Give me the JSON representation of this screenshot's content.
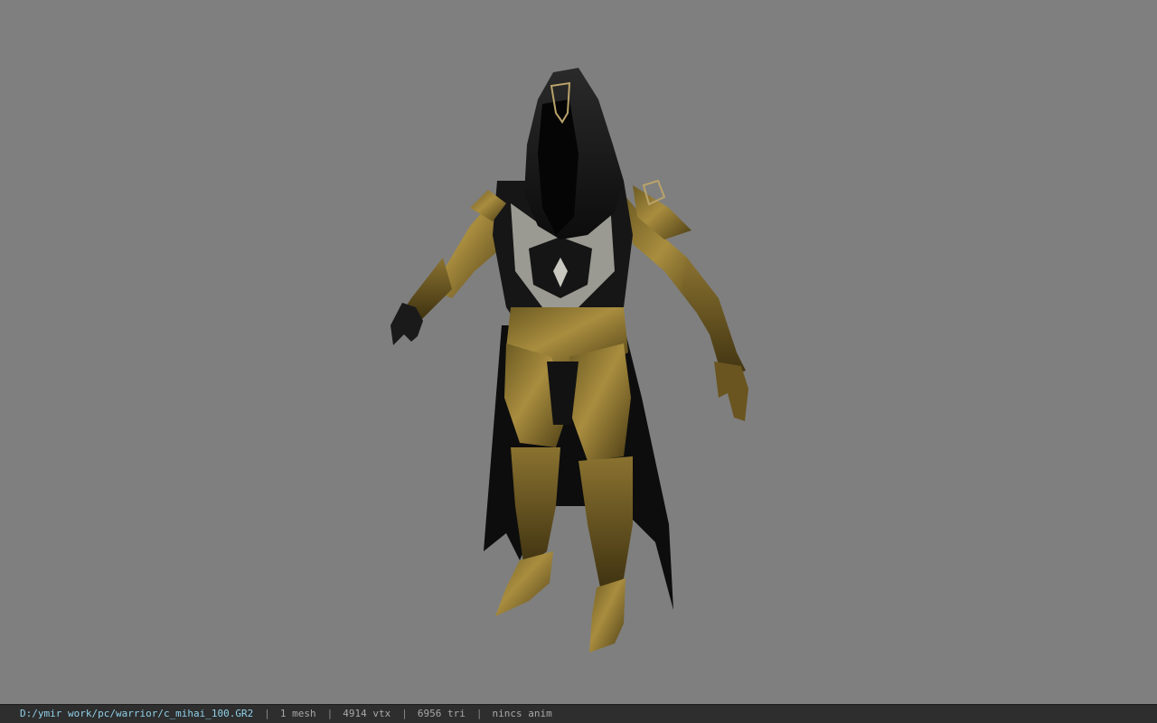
{
  "viewer": {
    "background_color": "#7f7f7f",
    "model_icon": "hooded-armored-warrior-model"
  },
  "status": {
    "file_path": "D:/ymir work/pc/warrior/c_mihai_100.GR2",
    "separator": "|",
    "mesh_count": "1 mesh",
    "vertex_count": "4914 vtx",
    "triangle_count": "6956 tri",
    "animation": "nincs anim"
  }
}
